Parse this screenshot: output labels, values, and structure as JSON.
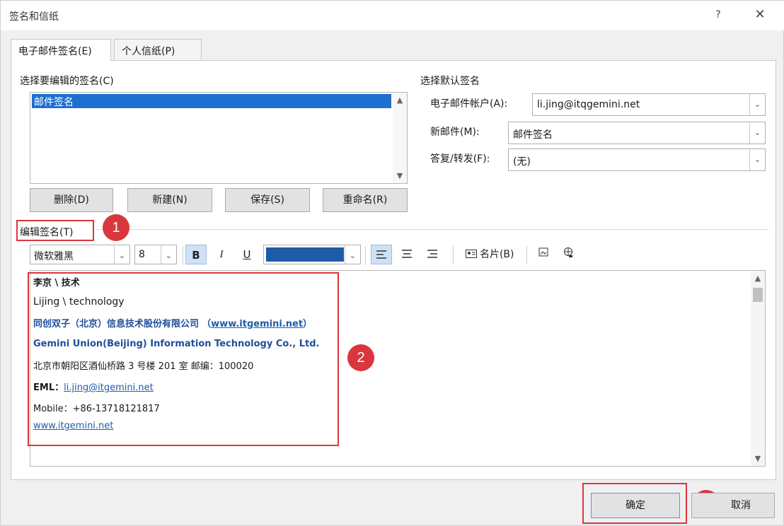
{
  "window": {
    "title": "签名和信纸",
    "help": "?",
    "close": "✕"
  },
  "tabs": [
    {
      "label": "电子邮件签名(E)"
    },
    {
      "label": "个人信纸(P)"
    }
  ],
  "select_signature": {
    "label": "选择要编辑的签名(C)",
    "items": [
      "邮件签名"
    ]
  },
  "buttons": {
    "delete": "删除(D)",
    "new": "新建(N)",
    "save": "保存(S)",
    "rename": "重命名(R)"
  },
  "default_signature": {
    "label": "选择默认签名",
    "account_label": "电子邮件帐户(A):",
    "account_value": "li.jing@itqgemini.net",
    "new_label": "新邮件(M):",
    "new_value": "邮件签名",
    "reply_label": "答复/转发(F):",
    "reply_value": "(无)"
  },
  "edit_signature": {
    "label": "编辑签名(T)"
  },
  "toolbar": {
    "font": "微软雅黑",
    "size": "8",
    "bold": "B",
    "italic": "I",
    "underline": "U",
    "color": "#1f5ba8",
    "business_card": "名片(B)"
  },
  "signature_body": {
    "name_cn": "李京 \\ 技术",
    "name_en": "Lijing \\ technology",
    "company_cn": "同创双子（北京）信息技术股份有限公司",
    "company_cn_link": "www.itgemini.net",
    "company_en": "Gemini Union(Beijing) Information Technology Co., Ltd.",
    "address": "北京市朝阳区酒仙桥路 3 号楼 201 室 邮编：100020",
    "email_prefix": "EML：",
    "email": "li.jing@itgemini.net",
    "mobile": "Mobile：+86-13718121817",
    "website": "www.itgemini.net"
  },
  "annotations": [
    "1",
    "2",
    "3"
  ],
  "footer": {
    "ok": "确定",
    "cancel": "取消"
  }
}
